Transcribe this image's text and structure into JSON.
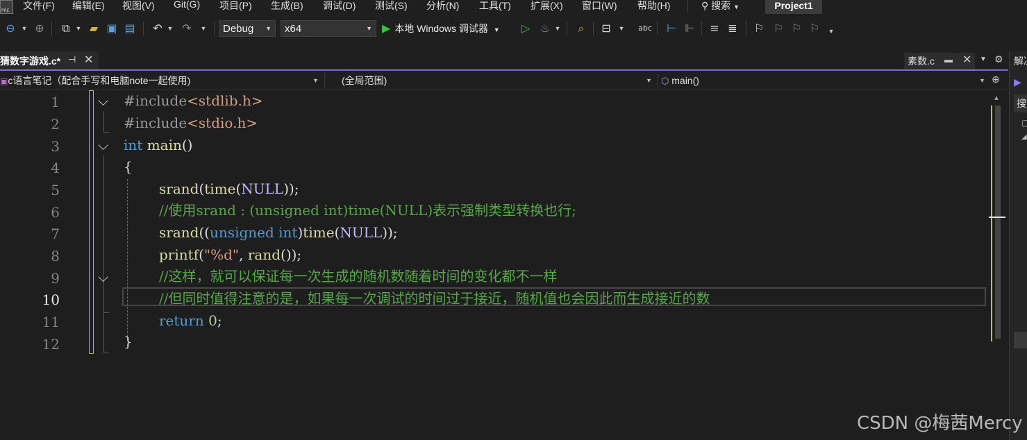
{
  "menubar": {
    "items": [
      "文件(F)",
      "编辑(E)",
      "视图(V)",
      "Git(G)",
      "项目(P)",
      "生成(B)",
      "调试(D)",
      "测试(S)",
      "分析(N)",
      "工具(T)",
      "扩展(X)",
      "窗口(W)",
      "帮助(H)"
    ],
    "search": "搜索",
    "project": "Project1",
    "logo_text": "PRE"
  },
  "toolbar": {
    "config": "Debug",
    "platform": "x64",
    "run_label": "本地 Windows 调试器",
    "icons": [
      "back-icon",
      "forward-icon",
      "new-project-icon",
      "open-folder-icon",
      "save-icon",
      "save-all-icon",
      "undo-icon",
      "redo-icon",
      "play-outline-icon",
      "hot-reload-icon",
      "find-in-files-icon",
      "layout-icon",
      "spell-check-icon",
      "step-icon",
      "comment-icon",
      "uncomment-icon",
      "bookmark-icon"
    ]
  },
  "tabs": {
    "active": "猜数字游戏.c*",
    "right": "素数.c"
  },
  "navbar": {
    "project": "c语言笔记（配合手写和电脑note一起使用)",
    "scope": "(全局范围)",
    "member": "main()"
  },
  "editor": {
    "line_numbers": [
      "1",
      "2",
      "3",
      "4",
      "5",
      "6",
      "7",
      "8",
      "9",
      "10",
      "11",
      "12"
    ],
    "current_line": 10,
    "code": {
      "l1": {
        "prep": "#include",
        "inc": "<stdlib.h>"
      },
      "l2": {
        "prep": "#include",
        "inc": "<stdio.h>"
      },
      "l3": {
        "kw": "int",
        "fn": "main",
        "rest": "()"
      },
      "l4": {
        "text": "{"
      },
      "l5": {
        "fn": "srand",
        "p1": "(",
        "fn2": "time",
        "p2": "(",
        "macro": "NULL",
        "p3": "));"
      },
      "l6": {
        "comment": "//使用srand : (unsigned int)time(NULL)表示强制类型转换也行;"
      },
      "l7": {
        "fn": "srand",
        "p1": "((",
        "kw1": "unsigned",
        "sp": " ",
        "kw2": "int",
        "p2": ")",
        "fn2": "time",
        "p3": "(",
        "macro": "NULL",
        "p4": "));"
      },
      "l8": {
        "fn": "printf",
        "p1": "(",
        "str": "\"%d\"",
        "p2": ", ",
        "fn2": "rand",
        "p3": "());"
      },
      "l9": {
        "comment": "//这样，就可以保证每一次生成的随机数随着时间的变化都不一样"
      },
      "l10": {
        "comment": "//但同时值得注意的是，如果每一次调试的时间过于接近，随机值也会因此而生成接近的数"
      },
      "l11": {
        "kw": "return",
        "sp": " ",
        "num": "0",
        "rest": ";"
      },
      "l12": {
        "text": "}"
      }
    }
  },
  "right_panel": {
    "title": "解决",
    "search": "搜"
  },
  "watermark": "CSDN @梅茜Mercy"
}
